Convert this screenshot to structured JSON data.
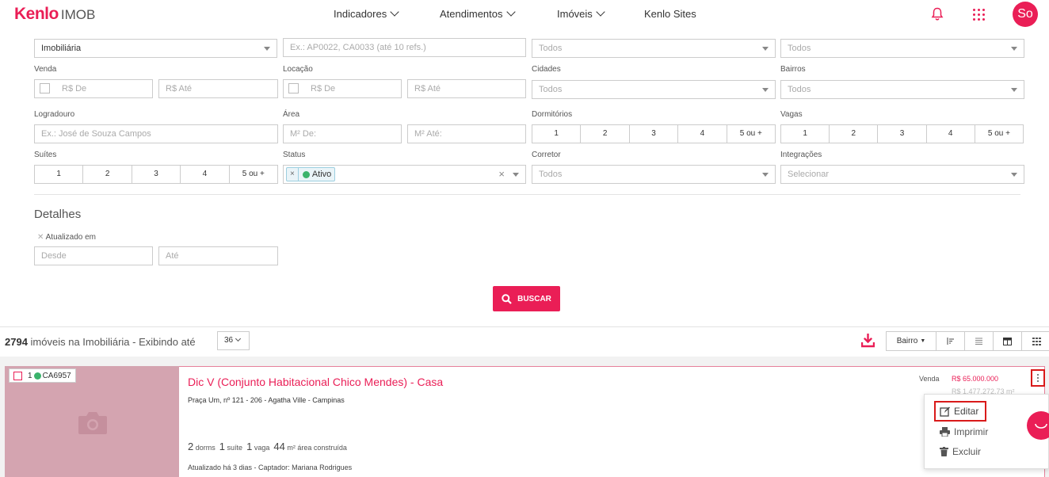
{
  "app": {
    "brand": "Kenlo",
    "brand_suffix": "IMOB",
    "accent": "#ea1e56",
    "avatar_initials": "So"
  },
  "nav": {
    "items": [
      "Indicadores",
      "Atendimentos",
      "Imóveis",
      "Kenlo Sites"
    ]
  },
  "filters": {
    "row1": {
      "imobiliaria": "Imobiliária",
      "ref_placeholder": "Ex.: AP0022, CA0033 (até 10 refs.)",
      "col3": "Todos",
      "col4": "Todos"
    },
    "venda": {
      "label": "Venda",
      "de": "R$ De",
      "ate": "R$ Até"
    },
    "locacao": {
      "label": "Locação",
      "de": "R$ De",
      "ate": "R$ Até"
    },
    "cidades": {
      "label": "Cidades",
      "value": "Todos"
    },
    "bairros": {
      "label": "Bairros",
      "value": "Todos"
    },
    "logradouro": {
      "label": "Logradouro",
      "placeholder": "Ex.: José de Souza Campos"
    },
    "area": {
      "label": "Área",
      "de": "M² De:",
      "ate": "M² Até:"
    },
    "dormitorios": {
      "label": "Dormitórios",
      "options": [
        "1",
        "2",
        "3",
        "4",
        "5 ou +"
      ]
    },
    "vagas": {
      "label": "Vagas",
      "options": [
        "1",
        "2",
        "3",
        "4",
        "5 ou +"
      ]
    },
    "suites": {
      "label": "Suítes",
      "options": [
        "1",
        "2",
        "3",
        "4",
        "5 ou +"
      ]
    },
    "status": {
      "label": "Status",
      "tag_remove": "×",
      "tag": "Ativo",
      "clear": "×"
    },
    "corretor": {
      "label": "Corretor",
      "value": "Todos"
    },
    "integracoes": {
      "label": "Integrações",
      "value": "Selecionar"
    }
  },
  "detalhes": {
    "title": "Detalhes",
    "clear_x": "✕",
    "atualizado_label": "Atualizado em",
    "desde": "Desde",
    "ate": "Até"
  },
  "search_button": "BUSCAR",
  "results": {
    "count": "2794",
    "text": "imóveis na Imobiliária - Exibindo até",
    "per_page": "36",
    "sort": "Bairro"
  },
  "property": {
    "index": "1",
    "code": "CA6957",
    "title": "Dic V (Conjunto Habitacional Chico Mendes) - Casa",
    "address": "Praça Um, nº 121 - 206 - Agatha Ville - Campinas",
    "features": {
      "dorms": "2",
      "dorms_label": "dorms",
      "suite": "1",
      "suite_label": "suíte",
      "vaga": "1",
      "vaga_label": "vaga",
      "area": "44",
      "area_label": "m² área construída"
    },
    "updated": "Atualizado há 3 dias - Captador: Mariana Rodrigues",
    "venda_label": "Venda",
    "price": "R$ 65.000.000",
    "price_m2": "R$ 1.477.272,73 m²"
  },
  "menu": {
    "editar": "Editar",
    "imprimir": "Imprimir",
    "excluir": "Excluir"
  }
}
